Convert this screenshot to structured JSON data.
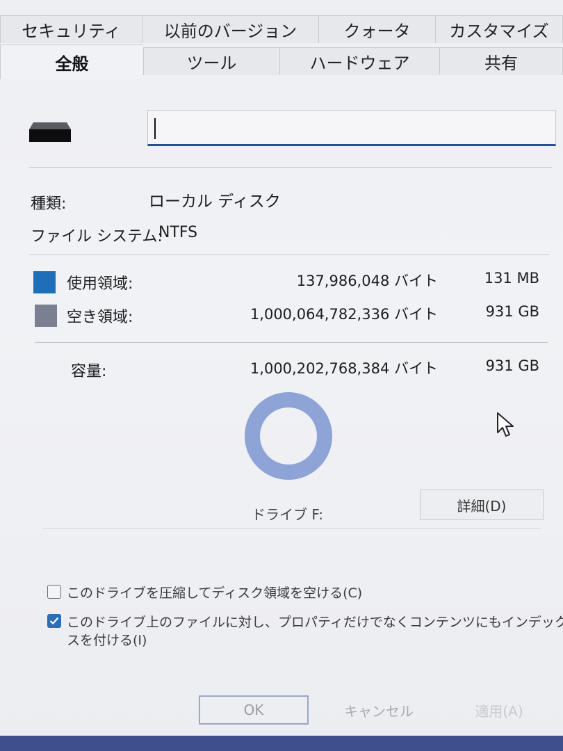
{
  "tabs_back": [
    "セキュリティ",
    "以前のバージョン",
    "クォータ",
    "カスタマイズ"
  ],
  "tabs_front": [
    "全般",
    "ツール",
    "ハードウェア",
    "共有"
  ],
  "name_field": {
    "value": ""
  },
  "info": {
    "type_label": "種類:",
    "type_value": "ローカル ディスク",
    "fs_label": "ファイル システム:",
    "fs_value": "NTFS"
  },
  "used": {
    "label": "使用領域:",
    "bytes": "137,986,048 バイト",
    "size": "131 MB",
    "color": "#1f6fb8"
  },
  "free": {
    "label": "空き領域:",
    "bytes": "1,000,064,782,336 バイト",
    "size": "931 GB",
    "color": "#7a7f91"
  },
  "capacity": {
    "label": "容量:",
    "bytes": "1,000,202,768,384 バイト",
    "size": "931 GB"
  },
  "drive_label": "ドライブ F:",
  "details_button": "詳細(D)",
  "checkboxes": [
    {
      "label": "このドライブを圧縮してディスク領域を空ける(C)",
      "checked": false
    },
    {
      "label_line1": "このドライブ上のファイルに対し、プロパティだけでなくコンテンツにもインデック",
      "label_line2": "スを付ける(I)",
      "checked": true
    }
  ],
  "footer": {
    "ok": "OK",
    "cancel": "キャンセル",
    "apply": "適用(A)"
  },
  "colors": {
    "accent": "#2a4d8f",
    "donut": "#8ea3d6"
  }
}
